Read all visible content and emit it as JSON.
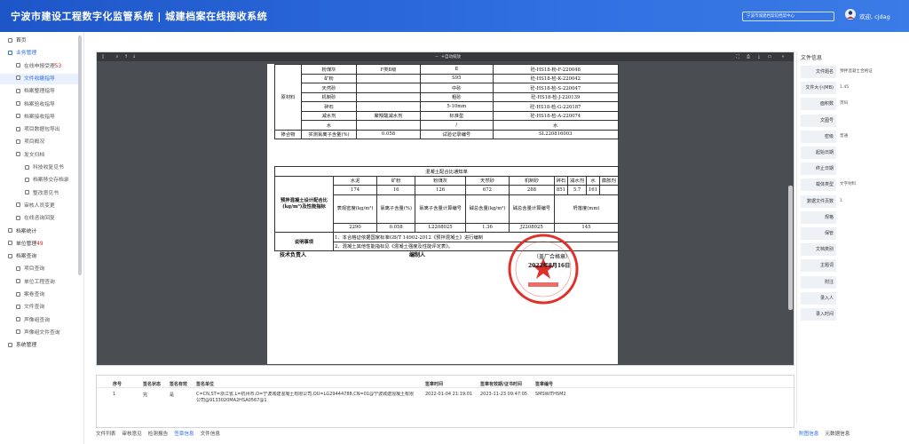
{
  "header": {
    "title": "宁波市建设工程数字化监管系统 | 城建档案在线接收系统",
    "org": "宁波市城建档案馆档案中心",
    "user": "欢迎, cjdag"
  },
  "sidebar": {
    "items": [
      {
        "label": "首页",
        "level": 1
      },
      {
        "label": "业务管理",
        "level": 1,
        "active": true
      },
      {
        "label": "在线申报受理",
        "badge": "53",
        "level": 2
      },
      {
        "label": "文件收缴指导",
        "level": 2,
        "selected": true
      },
      {
        "label": "档案整理指导",
        "level": 2
      },
      {
        "label": "档案验收指导",
        "level": 2
      },
      {
        "label": "档案接收指导",
        "level": 2
      },
      {
        "label": "项目数据包导出",
        "level": 2
      },
      {
        "label": "项目概况",
        "level": 2
      },
      {
        "label": "发文归档",
        "level": 2
      },
      {
        "label": "科技收复见书",
        "level": 3
      },
      {
        "label": "档案移交存档录",
        "level": 3
      },
      {
        "label": "整改意见书",
        "level": 3
      },
      {
        "label": "审核人员变更",
        "level": 2
      },
      {
        "label": "在线咨询回复",
        "level": 2
      },
      {
        "label": "档案统计",
        "level": 1
      },
      {
        "label": "单位管理",
        "badge": "49",
        "level": 1
      },
      {
        "label": "档案查询",
        "level": 1
      },
      {
        "label": "项目查询",
        "level": 2
      },
      {
        "label": "单位工程查询",
        "level": 2
      },
      {
        "label": "案卷查询",
        "level": 2
      },
      {
        "label": "文件查询",
        "level": 2
      },
      {
        "label": "声像组查询",
        "level": 2
      },
      {
        "label": "声像组文件查询",
        "level": 2
      },
      {
        "label": "系统管理",
        "level": 1
      }
    ]
  },
  "viewer": {
    "zoom": "自动缩放"
  },
  "doc": {
    "materials": [
      [
        "粉煤灰",
        "F类Ⅱ级",
        "Ⅱ",
        "砼-HS18-粉-F-220048"
      ],
      [
        "矿粉",
        "",
        "S95",
        "砼-HS18-检-K-220042"
      ],
      [
        "天然砂",
        "",
        "中砂",
        "砼-HS18-检-S-220047"
      ],
      [
        "机制砂",
        "",
        "粗砂",
        "砼-HS18-检-J-220139"
      ],
      [
        "碎石",
        "",
        "5-10mm",
        "砼-HS18-检-G-220187"
      ],
      [
        "减水剂",
        "聚羧酸减水剂",
        "标准型",
        "砼-HS18-检-A-220074"
      ],
      [
        "水",
        "",
        "/",
        "水"
      ]
    ],
    "material_label": "原材料",
    "admix_row": [
      "掺合物",
      "实测氯离子含量(%)",
      "0.058",
      "试验记录编号",
      "SL220816003"
    ],
    "mix_title": "混凝土配合比通知单",
    "mix_headers": [
      "水泥",
      "矿粉",
      "粉煤灰",
      "天然砂",
      "机制砂",
      "碎石",
      "减水剂",
      "水",
      "膨胀剂"
    ],
    "mix_values": [
      "174",
      "16",
      "126",
      "672",
      "288",
      "851",
      "5.7",
      "161",
      ""
    ],
    "mix_row_label": "预拌混凝土设计配合比(kg/m³)及性能指标",
    "perf_headers": [
      "表观密度(kg/m³)",
      "氯离子含量(%)",
      "氯离子含量计算编号",
      "碱总含量(kg/m³)",
      "碱总含量计算编号",
      "坍落度(mm)"
    ],
    "perf_values": [
      "2290",
      "0.058",
      "L2208025",
      "1.36",
      "J2208025",
      "145"
    ],
    "note_label": "说明事项",
    "notes": [
      "1、本合格证依据国家标准GB/T 14902-2012《预拌混凝土》进行编制",
      "2、混凝土其他性能指标见《混凝土强度及性能评定表》。"
    ],
    "tech_label": "技术负责人",
    "editor_label": "编制人",
    "stamp": "（盖厂合格章）",
    "stamp_date": "2022年8月16日"
  },
  "rpanel": {
    "title": "文件信息",
    "rows": [
      {
        "label": "文件题名",
        "value": "预拌混凝土合格证"
      },
      {
        "label": "文件大小(MB)",
        "value": "1.45"
      },
      {
        "label": "面积数",
        "value": "页码"
      },
      {
        "label": "文图号",
        "value": ""
      },
      {
        "label": "密级",
        "value": "普通"
      },
      {
        "label": "起始日期",
        "value": ""
      },
      {
        "label": "终止日期",
        "value": ""
      },
      {
        "label": "载体类型",
        "value": "文字材料"
      },
      {
        "label": "数据文件页数",
        "value": "1"
      },
      {
        "label": "规格",
        "value": ""
      },
      {
        "label": "保管",
        "value": ""
      },
      {
        "label": "文档类别",
        "value": ""
      },
      {
        "label": "主题词",
        "value": ""
      },
      {
        "label": "附注",
        "value": ""
      },
      {
        "label": "录入人",
        "value": ""
      },
      {
        "label": "录入时间",
        "value": ""
      }
    ]
  },
  "signature": {
    "headers": [
      "序号",
      "签名状态",
      "签名有效",
      "签名单位",
      "签章时间",
      "签章有效期/证书时间",
      "签章编号"
    ],
    "row": [
      "1",
      "完",
      "是",
      "C=CN,ST=浙江省,L=杭州市,O=宁波城建混凝土有限公司,OU=LG29444788,CN=01@宁波城建混凝土有限公司@9133020MA2HSA0567@1",
      "2022-01-04 21:19:01",
      "2023-11-23 09:47:05",
      "SMSWITHSM2"
    ]
  },
  "tabs": [
    "文件列表",
    "审核意见",
    "检测报告",
    "签章信息",
    "文件信息"
  ],
  "active_tab": 3,
  "rtabs": [
    "附图信息",
    "元数据信息"
  ]
}
